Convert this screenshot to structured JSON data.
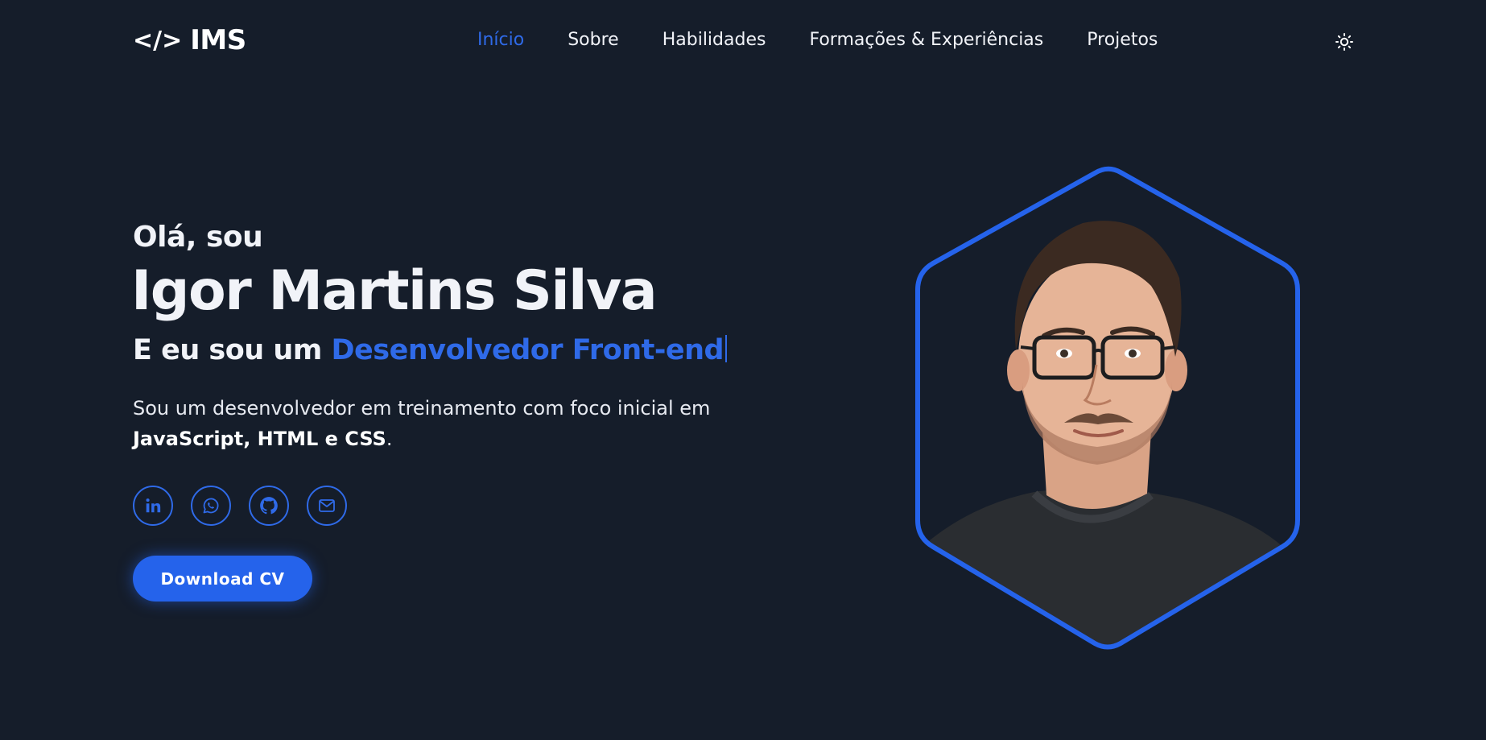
{
  "header": {
    "logo_mark": "</>",
    "logo_text": "IMS",
    "nav": [
      {
        "label": "Início",
        "active": true
      },
      {
        "label": "Sobre",
        "active": false
      },
      {
        "label": "Habilidades",
        "active": false
      },
      {
        "label": "Formações & Experiências",
        "active": false
      },
      {
        "label": "Projetos",
        "active": false
      }
    ],
    "theme_icon": "sun-icon"
  },
  "hero": {
    "greeting": "Olá, sou",
    "name": "Igor Martins Silva",
    "role_prefix": "E eu sou um ",
    "role_highlight": "Desenvolvedor Front-end",
    "description_text": "Sou um desenvolvedor em treinamento com foco inicial em",
    "description_tech": "JavaScript, HTML e CSS",
    "description_end": ".",
    "socials": [
      {
        "icon": "linkedin-icon"
      },
      {
        "icon": "whatsapp-icon"
      },
      {
        "icon": "github-icon"
      },
      {
        "icon": "mail-icon"
      }
    ],
    "cv_button": "Download CV"
  },
  "colors": {
    "background": "#151d2a",
    "accent": "#2f6ae8",
    "text": "#f1f3f8"
  }
}
